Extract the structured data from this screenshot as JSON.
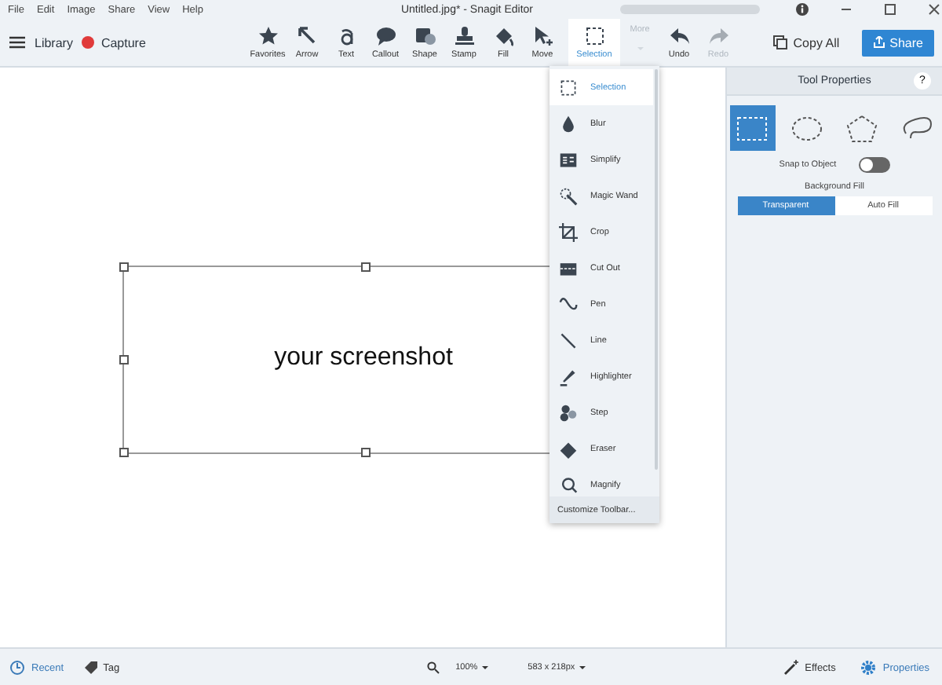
{
  "menu": [
    "File",
    "Edit",
    "Image",
    "Share",
    "View",
    "Help"
  ],
  "window": {
    "title": "Untitled.jpg* - Snagit Editor"
  },
  "left_toolbar": {
    "library": "Library",
    "capture": "Capture"
  },
  "tools": [
    {
      "label": "Favorites",
      "selected": false,
      "disabled": false
    },
    {
      "label": "Arrow",
      "selected": false,
      "disabled": false
    },
    {
      "label": "Text",
      "selected": false,
      "disabled": false
    },
    {
      "label": "Callout",
      "selected": false,
      "disabled": false
    },
    {
      "label": "Shape",
      "selected": false,
      "disabled": false
    },
    {
      "label": "Stamp",
      "selected": false,
      "disabled": false
    },
    {
      "label": "Fill",
      "selected": false,
      "disabled": false
    },
    {
      "label": "Move",
      "selected": false,
      "disabled": false
    },
    {
      "label": "Selection",
      "selected": true,
      "disabled": false
    },
    {
      "label": "More",
      "selected": false,
      "disabled": true
    },
    {
      "label": "Undo",
      "selected": false,
      "disabled": false
    },
    {
      "label": "Redo",
      "selected": false,
      "disabled": true
    }
  ],
  "actions": {
    "copy_all": "Copy All",
    "share": "Share"
  },
  "canvas": {
    "text": "your screenshot"
  },
  "dropdown": {
    "items": [
      {
        "label": "Selection",
        "selected": true
      },
      {
        "label": "Blur",
        "selected": false
      },
      {
        "label": "Simplify",
        "selected": false
      },
      {
        "label": "Magic Wand",
        "selected": false
      },
      {
        "label": "Crop",
        "selected": false
      },
      {
        "label": "Cut Out",
        "selected": false
      },
      {
        "label": "Pen",
        "selected": false
      },
      {
        "label": "Line",
        "selected": false
      },
      {
        "label": "Highlighter",
        "selected": false
      },
      {
        "label": "Step",
        "selected": false
      },
      {
        "label": "Eraser",
        "selected": false
      },
      {
        "label": "Magnify",
        "selected": false
      }
    ],
    "footer": "Customize Toolbar..."
  },
  "tool_properties": {
    "title": "Tool Properties",
    "help": "?",
    "shapes": [
      {
        "selected": true
      },
      {
        "selected": false
      },
      {
        "selected": false
      },
      {
        "selected": false
      }
    ],
    "snap_label": "Snap to Object",
    "snap_on": false,
    "fill_label": "Background Fill",
    "fill_options": [
      {
        "label": "Transparent",
        "selected": true
      },
      {
        "label": "Auto Fill",
        "selected": false
      }
    ]
  },
  "status_bar": {
    "recent": "Recent",
    "tag": "Tag",
    "zoom": "100%",
    "size": "583 x 218px",
    "effects": "Effects",
    "properties": "Properties"
  }
}
